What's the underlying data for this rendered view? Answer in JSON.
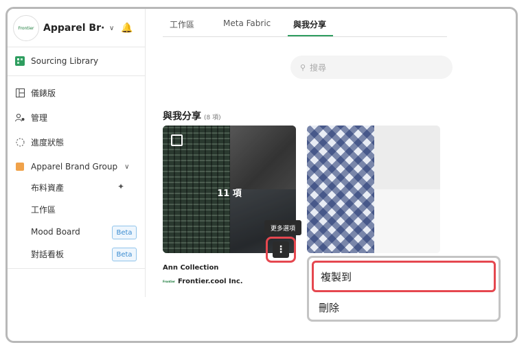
{
  "sidebar": {
    "logo_text": "Frontier",
    "org_name": "Apparel Br···",
    "sourcing": "Sourcing Library",
    "items": [
      {
        "label": "儀錶版"
      },
      {
        "label": "管理"
      },
      {
        "label": "進度狀態"
      },
      {
        "label": "Apparel Brand Group"
      }
    ],
    "sub_items": [
      {
        "label": "布料資產"
      },
      {
        "label": "工作區"
      },
      {
        "label": "Mood Board",
        "badge": "Beta"
      },
      {
        "label": "對話看板",
        "badge": "Beta"
      }
    ]
  },
  "tabs": [
    {
      "label": "工作區",
      "active": false
    },
    {
      "label": "Meta Fabric",
      "active": false
    },
    {
      "label": "與我分享",
      "active": true
    }
  ],
  "search": {
    "placeholder": "搜尋"
  },
  "section": {
    "title": "與我分享",
    "count": "(8 項)"
  },
  "cards": [
    {
      "count_label": "11 項",
      "title": "Ann Collection",
      "owner": "Frontier.cool Inc.",
      "owner_logo": "Frontier",
      "tooltip": "更多選項"
    },
    {
      "title": ""
    }
  ],
  "menu": {
    "items": [
      {
        "label": "複製到"
      },
      {
        "label": "刪除"
      }
    ]
  },
  "colors": {
    "accent": "#2e9d5f",
    "highlight": "#e5474f",
    "beta": "#3a8bd0"
  }
}
